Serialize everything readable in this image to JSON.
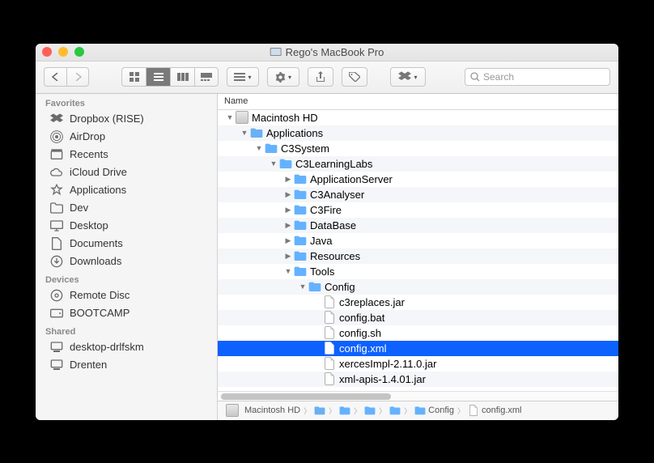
{
  "window": {
    "title": "Rego's MacBook Pro"
  },
  "search": {
    "placeholder": "Search"
  },
  "column_header": "Name",
  "sidebar": {
    "favorites_label": "Favorites",
    "devices_label": "Devices",
    "shared_label": "Shared",
    "favorites": [
      {
        "label": "Dropbox (RISE)",
        "icon": "dropbox"
      },
      {
        "label": "AirDrop",
        "icon": "airdrop"
      },
      {
        "label": "Recents",
        "icon": "recents"
      },
      {
        "label": "iCloud Drive",
        "icon": "icloud"
      },
      {
        "label": "Applications",
        "icon": "apps"
      },
      {
        "label": "Dev",
        "icon": "folder"
      },
      {
        "label": "Desktop",
        "icon": "desktop"
      },
      {
        "label": "Documents",
        "icon": "documents"
      },
      {
        "label": "Downloads",
        "icon": "downloads"
      }
    ],
    "devices": [
      {
        "label": "Remote Disc",
        "icon": "disc"
      },
      {
        "label": "BOOTCAMP",
        "icon": "drive"
      }
    ],
    "shared": [
      {
        "label": "desktop-drlfskm",
        "icon": "pc"
      },
      {
        "label": "Drenten",
        "icon": "pc"
      }
    ]
  },
  "tree": [
    {
      "indent": 0,
      "arrow": "down",
      "icon": "disk",
      "label": "Macintosh HD"
    },
    {
      "indent": 1,
      "arrow": "down",
      "icon": "appfolder",
      "label": "Applications"
    },
    {
      "indent": 2,
      "arrow": "down",
      "icon": "folder",
      "label": "C3System"
    },
    {
      "indent": 3,
      "arrow": "down",
      "icon": "folder",
      "label": "C3LearningLabs"
    },
    {
      "indent": 4,
      "arrow": "right",
      "icon": "folder",
      "label": "ApplicationServer"
    },
    {
      "indent": 4,
      "arrow": "right",
      "icon": "folder",
      "label": "C3Analyser"
    },
    {
      "indent": 4,
      "arrow": "right",
      "icon": "folder",
      "label": "C3Fire"
    },
    {
      "indent": 4,
      "arrow": "right",
      "icon": "folder",
      "label": "DataBase"
    },
    {
      "indent": 4,
      "arrow": "right",
      "icon": "folder",
      "label": "Java"
    },
    {
      "indent": 4,
      "arrow": "right",
      "icon": "folder",
      "label": "Resources"
    },
    {
      "indent": 4,
      "arrow": "down",
      "icon": "folder",
      "label": "Tools"
    },
    {
      "indent": 5,
      "arrow": "down",
      "icon": "folder",
      "label": "Config"
    },
    {
      "indent": 6,
      "arrow": "",
      "icon": "jar",
      "label": "c3replaces.jar"
    },
    {
      "indent": 6,
      "arrow": "",
      "icon": "file",
      "label": "config.bat"
    },
    {
      "indent": 6,
      "arrow": "",
      "icon": "file",
      "label": "config.sh"
    },
    {
      "indent": 6,
      "arrow": "",
      "icon": "file",
      "label": "config.xml",
      "selected": true
    },
    {
      "indent": 6,
      "arrow": "",
      "icon": "jar",
      "label": "xercesImpl-2.11.0.jar"
    },
    {
      "indent": 6,
      "arrow": "",
      "icon": "jar",
      "label": "xml-apis-1.4.01.jar"
    }
  ],
  "path": [
    {
      "label": "Macintosh HD",
      "icon": "disk"
    },
    {
      "label": "",
      "icon": "appfolder"
    },
    {
      "label": "",
      "icon": "folder"
    },
    {
      "label": "",
      "icon": "folder"
    },
    {
      "label": "",
      "icon": "folder"
    },
    {
      "label": "Config",
      "icon": "folder"
    },
    {
      "label": "config.xml",
      "icon": "file"
    }
  ]
}
